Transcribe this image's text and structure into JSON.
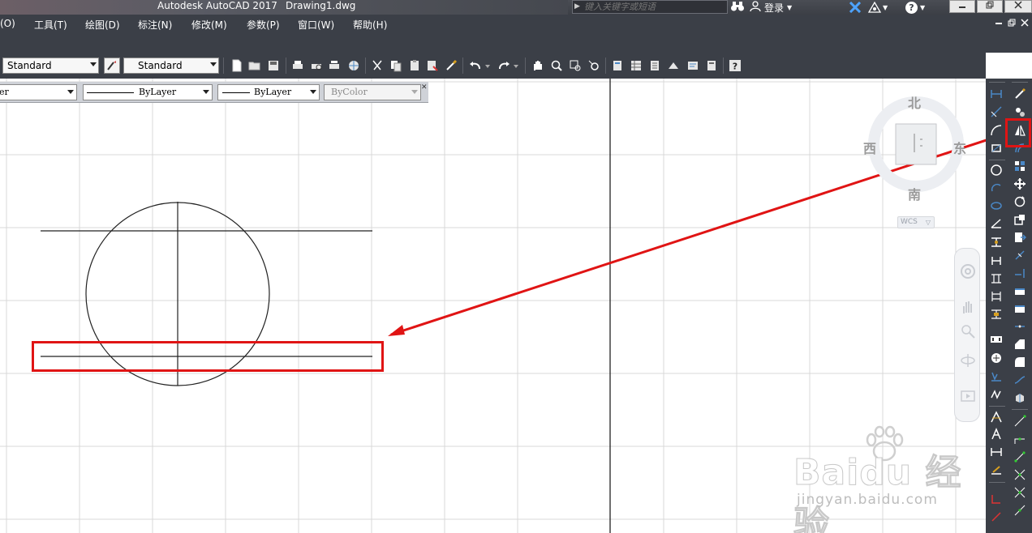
{
  "window": {
    "app_title": "Autodesk AutoCAD 2017",
    "file_title": "Drawing1.dwg",
    "search_placeholder": "键入关键字或短语",
    "login_label": "登录",
    "help_label": "?"
  },
  "menu": {
    "items": [
      "(O)",
      "工具(T)",
      "绘图(D)",
      "标注(N)",
      "修改(M)",
      "参数(P)",
      "窗口(W)",
      "帮助(H)"
    ]
  },
  "toolbar": {
    "text_style": "Standard",
    "dim_style": "Standard"
  },
  "layers": {
    "layer_name": "er",
    "color": "ByLayer",
    "linetype": "ByLayer",
    "lineweight": "ByColor"
  },
  "viewcube": {
    "north": "北",
    "south": "南",
    "west": "西",
    "east": "东",
    "wcs_label": "WCS"
  },
  "watermark": {
    "text": "Baidu 经验",
    "url": "jingyan.baidu.com"
  },
  "colors": {
    "highlight": "#e01414",
    "chrome_dark": "#3b3f47",
    "grid": "#d8d8d8"
  }
}
